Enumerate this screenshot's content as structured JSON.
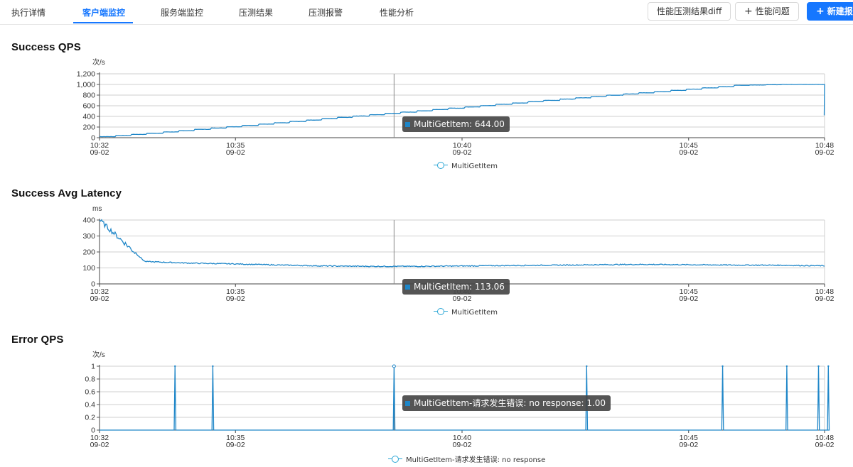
{
  "tabs": [
    {
      "label": "执行详情",
      "active": false
    },
    {
      "label": "客户端监控",
      "active": true
    },
    {
      "label": "服务端监控",
      "active": false
    },
    {
      "label": "压测结果",
      "active": false
    },
    {
      "label": "压测报警",
      "active": false
    },
    {
      "label": "性能分析",
      "active": false
    }
  ],
  "buttons": {
    "diff": "性能压测结果diff",
    "issue": "性能问题",
    "create": "新建报"
  },
  "colors": {
    "accent": "#1677ff",
    "series": "#1e86c8",
    "tooltip_bg": "#464646"
  },
  "icons": {
    "plus": "plus-icon"
  },
  "charts": [
    {
      "title": "Success QPS",
      "unit": "次/s",
      "tooltip": "MultiGetItem: 644.00",
      "legend": "MultiGetItem"
    },
    {
      "title": "Success Avg Latency",
      "unit": "ms",
      "tooltip": "MultiGetItem: 113.06",
      "legend": "MultiGetItem"
    },
    {
      "title": "Error QPS",
      "unit": "次/s",
      "tooltip": "MultiGetItem-请求发生错误: no response: 1.00",
      "legend": "MultiGetItem-请求发生错误: no response"
    }
  ],
  "chart_data": [
    {
      "type": "line",
      "title": "Success QPS",
      "ylabel": "次/s",
      "x_ticks": [
        "10:32\n09-02",
        "10:35\n09-02",
        "10:40\n09-02",
        "10:45\n09-02",
        "10:48\n09-02"
      ],
      "x_tick_minutes": [
        "10:32",
        "10:35",
        "10:40",
        "10:45",
        "10:48"
      ],
      "xlim": [
        "10:32",
        "10:48"
      ],
      "y_ticks": [
        "0",
        "200",
        "400",
        "600",
        "800",
        "1,000",
        "1,200"
      ],
      "ylim": [
        0,
        1200
      ],
      "grid": true,
      "legend_position": "bottom-center",
      "series": [
        {
          "name": "MultiGetItem",
          "x": [
            "10:32",
            "10:33",
            "10:34",
            "10:35",
            "10:36",
            "10:37",
            "10:38",
            "10:39",
            "10:40",
            "10:41",
            "10:42",
            "10:43",
            "10:44",
            "10:45",
            "10:46",
            "10:47",
            "10:48"
          ],
          "values": [
            20,
            80,
            150,
            220,
            290,
            365,
            435,
            505,
            575,
            645,
            715,
            785,
            850,
            915,
            985,
            1000,
            1000
          ]
        }
      ],
      "end_drop": 420,
      "crosshair": "10:38:30",
      "tooltip_value": 644.0
    },
    {
      "type": "line",
      "title": "Success Avg Latency",
      "ylabel": "ms",
      "x_ticks": [
        "10:32\n09-02",
        "10:35\n09-02",
        "10:40\n09-02",
        "10:45\n09-02",
        "10:48\n09-02"
      ],
      "x_tick_minutes": [
        "10:32",
        "10:35",
        "10:40",
        "10:45",
        "10:48"
      ],
      "xlim": [
        "10:32",
        "10:48"
      ],
      "y_ticks": [
        "0",
        "100",
        "200",
        "300",
        "400"
      ],
      "ylim": [
        0,
        400
      ],
      "grid": true,
      "legend_position": "bottom-center",
      "series": [
        {
          "name": "MultiGetItem",
          "x": [
            "10:32",
            "10:33",
            "10:34",
            "10:35",
            "10:36",
            "10:37",
            "10:38",
            "10:39",
            "10:40",
            "10:41",
            "10:42",
            "10:43",
            "10:44",
            "10:45",
            "10:46",
            "10:47",
            "10:48"
          ],
          "values": [
            400,
            140,
            130,
            125,
            118,
            112,
            110,
            110,
            112,
            115,
            117,
            120,
            122,
            120,
            118,
            117,
            113
          ]
        }
      ],
      "crosshair": "10:38:30",
      "tooltip_value": 113.06
    },
    {
      "type": "line",
      "title": "Error QPS",
      "ylabel": "次/s",
      "x_ticks": [
        "10:32\n09-02",
        "10:35\n09-02",
        "10:40\n09-02",
        "10:45\n09-02",
        "10:48\n09-02"
      ],
      "x_tick_minutes": [
        "10:32",
        "10:35",
        "10:40",
        "10:45",
        "10:48"
      ],
      "xlim": [
        "10:32",
        "10:48"
      ],
      "y_ticks": [
        "0",
        "0.2",
        "0.4",
        "0.6",
        "0.8",
        "1"
      ],
      "ylim": [
        0,
        1
      ],
      "grid": true,
      "legend_position": "bottom-center",
      "series": [
        {
          "name": "MultiGetItem-请求发生错误: no response",
          "spike_times": [
            "10:33:40",
            "10:34:30",
            "10:38:30",
            "10:42:45",
            "10:45:45",
            "10:47:10",
            "10:47:52",
            "10:48:05"
          ],
          "spike_values": [
            1,
            1,
            1,
            1,
            1,
            1,
            1,
            1
          ],
          "baseline": 0
        }
      ],
      "crosshair": "10:38:30",
      "tooltip_value": 1.0
    }
  ]
}
